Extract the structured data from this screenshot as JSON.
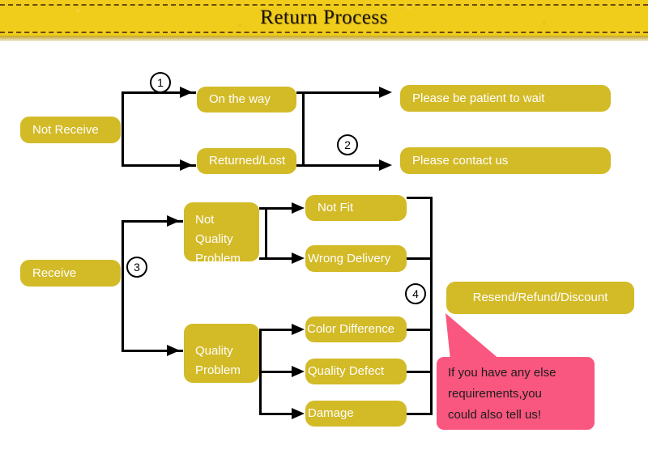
{
  "header": {
    "title": "Return Process",
    "banner_color": "#f0cd1a",
    "dash_color": "#6b4a12"
  },
  "theme": {
    "node_color": "#d3ba27",
    "node_text_color": "#ffffff",
    "connector_color": "#000000",
    "callout_color": "#f9577f",
    "callout_text_color": "#1c1c1c",
    "page_background": "#ffffff"
  },
  "flow": {
    "roots": [
      {
        "id": "not-receive",
        "label": "Not Receive"
      },
      {
        "id": "receive",
        "label": "Receive"
      }
    ],
    "stage_two": [
      {
        "id": "on-the-way",
        "label": "On the way"
      },
      {
        "id": "returned-lost",
        "label": "Returned/Lost"
      },
      {
        "id": "not-quality-problem",
        "label": "Not\nQuality\nProblem"
      },
      {
        "id": "quality-problem",
        "label": "Quality\nProblem"
      }
    ],
    "not_quality_problem_lines": {
      "line1": "Not",
      "line2": "Quality",
      "line3": "Problem"
    },
    "quality_problem_lines": {
      "line1": "Quality",
      "line2": "Problem"
    },
    "outcomes_top": [
      {
        "id": "be-patient",
        "label": "Please be patient to wait"
      },
      {
        "id": "contact-us",
        "label": "Please contact us"
      }
    ],
    "reasons_not_quality": [
      {
        "id": "not-fit",
        "label": "Not Fit"
      },
      {
        "id": "wrong-delivery",
        "label": "Wrong Delivery"
      }
    ],
    "reasons_quality": [
      {
        "id": "color-difference",
        "label": "Color Difference"
      },
      {
        "id": "quality-defect",
        "label": "Quality Defect"
      },
      {
        "id": "damage",
        "label": "Damage"
      }
    ],
    "final_outcome": {
      "id": "resend-refund-discount",
      "label": "Resend/Refund/Discount"
    }
  },
  "steps": [
    {
      "id": "step-1",
      "label": "1"
    },
    {
      "id": "step-2",
      "label": "2"
    },
    {
      "id": "step-3",
      "label": "3"
    },
    {
      "id": "step-4",
      "label": "4"
    }
  ],
  "callout": {
    "line1": "If you have any else",
    "line2": "requirements,you",
    "line3": "could also tell us!"
  }
}
